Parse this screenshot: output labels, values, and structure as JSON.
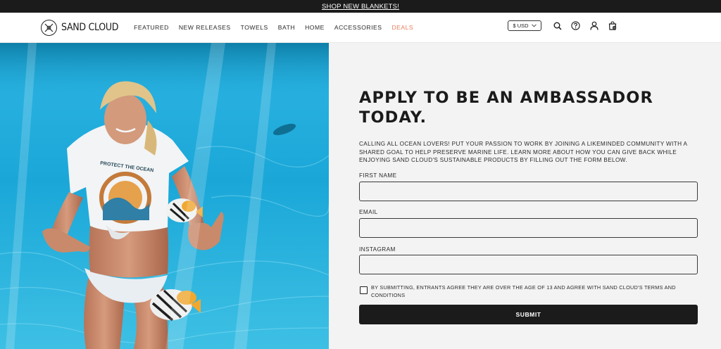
{
  "announcement": {
    "link_text": "SHOP NEW BLANKETS!"
  },
  "header": {
    "logo_text": "SAND CLOUD",
    "nav": [
      "FEATURED",
      "NEW RELEASES",
      "TOWELS",
      "BATH",
      "HOME",
      "ACCESSORIES",
      "DEALS"
    ],
    "currency": "$ USD",
    "cart_count": "0",
    "icons": [
      "search-icon",
      "help-icon",
      "account-icon",
      "cart-icon"
    ]
  },
  "hero": {
    "shirt_text": "PROTECT THE OCEAN"
  },
  "form": {
    "title_line1": "APPLY TO BE AN AMBASSADOR",
    "title_line2": "TODAY.",
    "intro": "CALLING ALL OCEAN LOVERS! PUT YOUR PASSION TO WORK BY JOINING A LIKEMINDED COMMUNITY WITH A SHARED GOAL TO HELP PRESERVE MARINE LIFE. LEARN MORE ABOUT HOW YOU CAN GIVE BACK WHILE ENJOYING SAND CLOUD'S SUSTAINABLE PRODUCTS BY FILLING OUT THE FORM BELOW.",
    "first_name_label": "FIRST NAME",
    "first_name_value": "",
    "email_label": "EMAIL",
    "email_value": "",
    "instagram_label": "INSTAGRAM",
    "instagram_value": "",
    "terms": "BY SUBMITTING, ENTRANTS AGREE THEY ARE OVER THE AGE OF 13 AND AGREE WITH SAND CLOUD'S TERMS AND CONDITIONS",
    "submit_label": "SUBMIT"
  },
  "colors": {
    "dark": "#1b1b1b",
    "deals": "#e8805e",
    "panel_bg": "#f3f3f3",
    "water": "#1aa9d8"
  }
}
